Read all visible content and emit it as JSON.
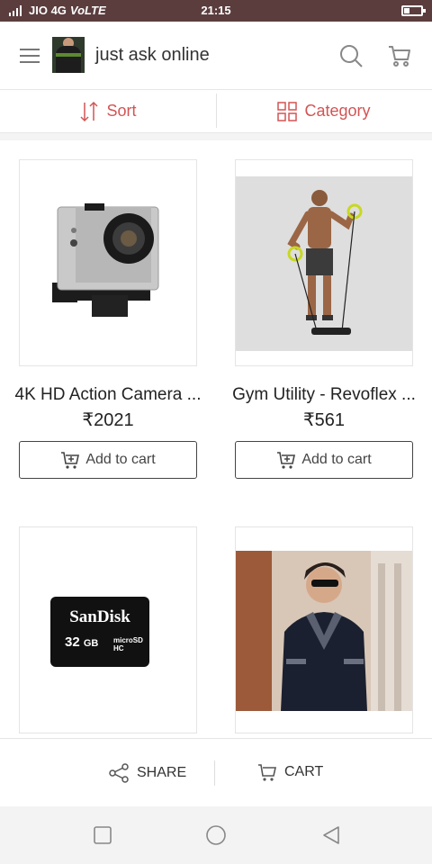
{
  "status_bar": {
    "carrier": "JIO 4G",
    "network_mode": "VoLTE",
    "time": "21:15",
    "battery_level": 0.35,
    "background_color": "#5b3d3e"
  },
  "header": {
    "menu_icon": "hamburger-menu-icon",
    "logo_image": "store-logo-avatar",
    "title": "just ask online",
    "search_icon": "search-icon",
    "cart_icon": "cart-icon"
  },
  "filters": {
    "sort_label": "Sort",
    "sort_icon": "sort-arrows-icon",
    "category_label": "Category",
    "category_icon": "grid-icon",
    "accent_color": "#d35454"
  },
  "products": [
    {
      "name": "4K HD Action Camera ...",
      "price": "₹2021",
      "add_label": "Add to cart",
      "image": "action-camera-image"
    },
    {
      "name": "Gym Utility - Revoflex ...",
      "price": "₹561",
      "add_label": "Add to cart",
      "image": "gym-revoflex-image"
    },
    {
      "name": "",
      "price": "",
      "add_label": "",
      "image": "sandisk-card-image",
      "card_brand": "SanDisk",
      "card_capacity": "32",
      "card_unit": "GB",
      "card_type": "microSD HC"
    },
    {
      "name": "",
      "price": "",
      "add_label": "",
      "image": "men-tshirt-image"
    }
  ],
  "bottom_bar": {
    "share_label": "SHARE",
    "share_icon": "share-icon",
    "cart_label": "CART",
    "cart_icon": "cart-icon"
  },
  "nav_bar": {
    "recents_icon": "square-recents-icon",
    "home_icon": "circle-home-icon",
    "back_icon": "triangle-back-icon"
  }
}
